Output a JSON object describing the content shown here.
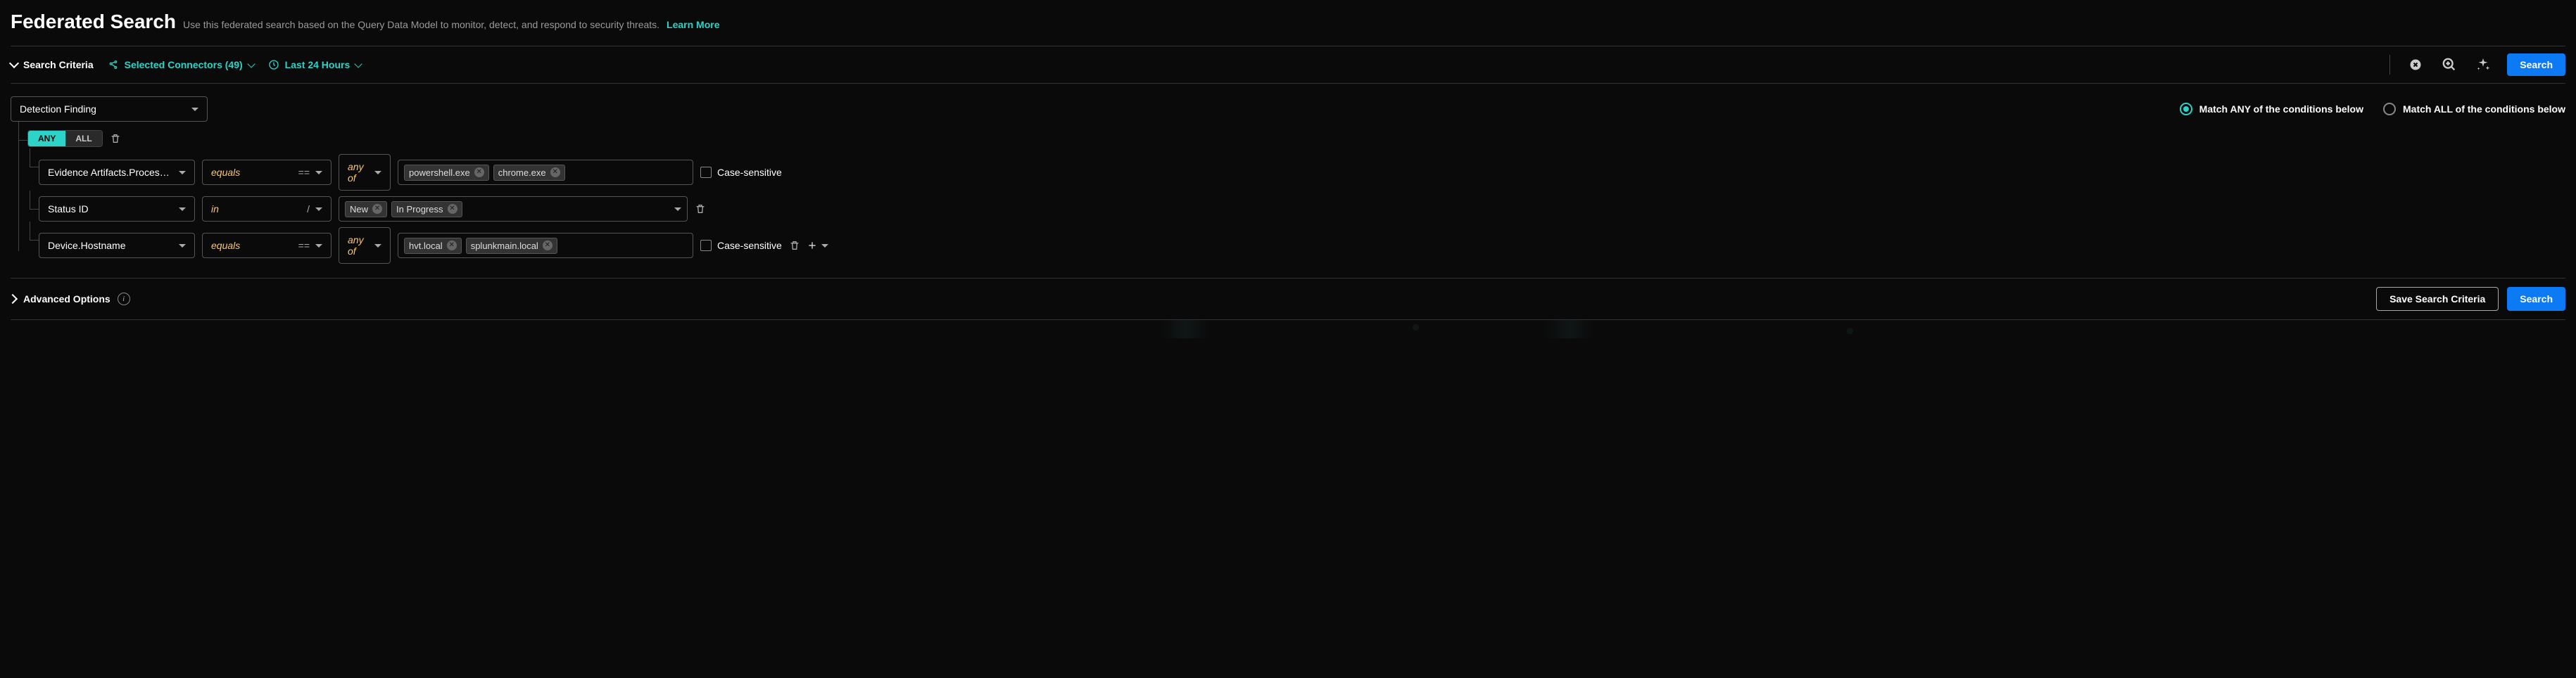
{
  "header": {
    "title": "Federated Search",
    "subtitle": "Use this federated search based on the Query Data Model to monitor, detect, and respond to security threats.",
    "learn_more": "Learn More"
  },
  "toolbar": {
    "criteria_label": "Search Criteria",
    "connectors_label": "Selected Connectors (49)",
    "timerange_label": "Last 24 Hours",
    "search_btn": "Search"
  },
  "builder": {
    "event_type": "Detection Finding",
    "match_any_label": "Match ANY of the conditions below",
    "match_all_label": "Match ALL of the conditions below",
    "match_mode": "any",
    "group_toggle_any": "ANY",
    "group_toggle_all": "ALL",
    "group_mode": "ANY",
    "case_sensitive_label": "Case-sensitive",
    "rules": [
      {
        "field": "Evidence Artifacts.Proces…",
        "operator": "equals",
        "op_sym": "==",
        "value_mode": "any of",
        "values": [
          "powershell.exe",
          "chrome.exe"
        ],
        "show_anyof": true,
        "show_case": true,
        "show_trash": false,
        "show_add": false,
        "value_style": "wide"
      },
      {
        "field": "Status ID",
        "operator": "in",
        "op_sym": "/",
        "value_mode": null,
        "values": [
          "New",
          "In Progress"
        ],
        "show_anyof": false,
        "show_case": false,
        "show_trash": true,
        "show_add": false,
        "value_style": "narrow"
      },
      {
        "field": "Device.Hostname",
        "operator": "equals",
        "op_sym": "==",
        "value_mode": "any of",
        "values": [
          "hvt.local",
          "splunkmain.local"
        ],
        "show_anyof": true,
        "show_case": true,
        "show_trash": true,
        "show_add": true,
        "value_style": "wide"
      }
    ]
  },
  "advanced": {
    "label": "Advanced Options",
    "save_btn": "Save Search Criteria",
    "search_btn": "Search"
  }
}
